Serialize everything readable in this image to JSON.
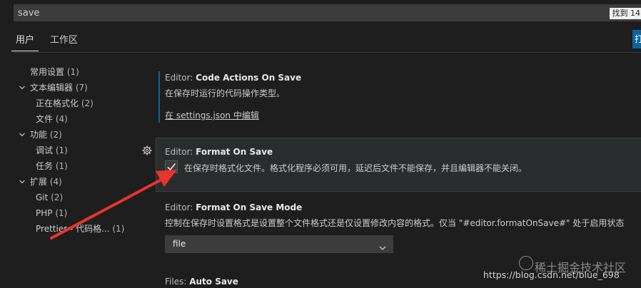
{
  "search": {
    "value": "save",
    "result_count": "找到 14"
  },
  "tabs": [
    {
      "label": "用户"
    },
    {
      "label": "工作区"
    }
  ],
  "open_json_button": "打",
  "toc": {
    "items": [
      {
        "label": "常用设置",
        "count": "(1)"
      },
      {
        "label": "文本编辑器",
        "count": "(7)"
      },
      {
        "label": "正在格式化",
        "count": "(2)"
      },
      {
        "label": "文件",
        "count": "(4)"
      },
      {
        "label": "功能",
        "count": "(2)"
      },
      {
        "label": "调试",
        "count": "(1)"
      },
      {
        "label": "任务",
        "count": "(1)"
      },
      {
        "label": "扩展",
        "count": "(4)"
      },
      {
        "label": "Git",
        "count": "(2)"
      },
      {
        "label": "PHP",
        "count": "(1)"
      },
      {
        "label": "Prettier - 代码格...",
        "count": "(1)"
      }
    ]
  },
  "settings": [
    {
      "category": "Editor: ",
      "key": "Code Actions On Save",
      "description": "在保存时运行的代码操作类型。",
      "link": "在 settings.json 中编辑"
    },
    {
      "category": "Editor: ",
      "key": "Format On Save",
      "description": "在保存时格式化文件。格式化程序必须可用，延迟后文件不能保存，并且编辑器不能关闭。",
      "checked": true
    },
    {
      "category": "Editor: ",
      "key": "Format On Save Mode",
      "description": "控制在保存时设置格式是设置整个文件格式还是仅设置修改内容的格式。仅当 \"#editor.formatOnSave#\" 处于启用状态",
      "select_value": "file"
    },
    {
      "category": "Files: ",
      "key": "Auto Save"
    }
  ],
  "watermark": {
    "brand": "稀土掘金技术社区",
    "url": "https://blog.csdn.net/blue_698"
  },
  "colors": {
    "background": "#1e1e1e",
    "accent": "#0e639c",
    "arrow": "#e8342d"
  }
}
